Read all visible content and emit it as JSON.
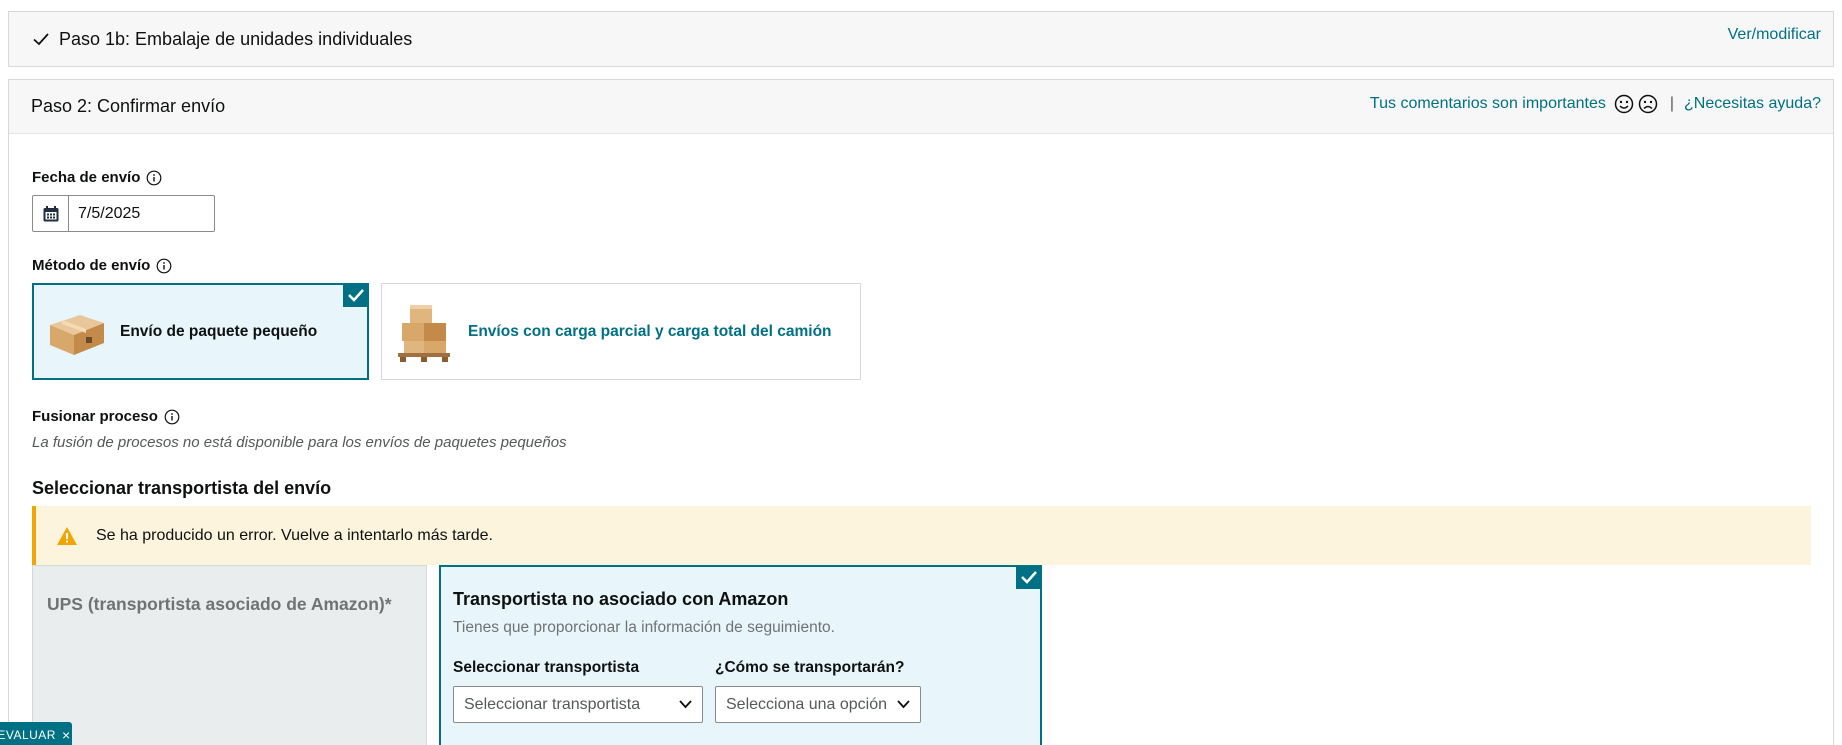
{
  "step1b": {
    "title": "Paso 1b: Embalaje de unidades individuales",
    "modify_link": "Ver/modificar"
  },
  "step2": {
    "title": "Paso 2: Confirmar envío",
    "feedback_link": "Tus comentarios son importantes",
    "separator": "|",
    "help_link": "¿Necesitas ayuda?"
  },
  "ship_date": {
    "label": "Fecha de envío",
    "value": "7/5/2025"
  },
  "ship_method": {
    "label": "Método de envío",
    "options": [
      {
        "label": "Envío de paquete pequeño",
        "selected": true
      },
      {
        "label": "Envíos con carga parcial y carga total del camión",
        "selected": false
      }
    ]
  },
  "merge": {
    "label": "Fusionar proceso",
    "note": "La fusión de procesos no está disponible para los envíos de paquetes pequeños"
  },
  "carrier_section": {
    "title": "Seleccionar transportista del envío",
    "alert": "Se ha producido un error. Vuelve a intentarlo más tarde.",
    "partnered": {
      "title": "UPS (transportista asociado de Amazon)*",
      "disabled": true
    },
    "non_partnered": {
      "title": "Transportista no asociado con Amazon",
      "subtitle": "Tienes que proporcionar la información de seguimiento.",
      "carrier_label": "Seleccionar transportista",
      "carrier_value": "Seleccionar transportista",
      "mode_label": "¿Cómo se transportarán?",
      "mode_value": "Selecciona una opción",
      "selected": true
    }
  },
  "evaluar_tab": {
    "label": "EVALUAR",
    "close": "×"
  },
  "colors": {
    "accent": "#007185",
    "alert_bg": "#fcf4dc",
    "alert_border": "#f0a500",
    "selected_bg": "#e8f6fb"
  }
}
